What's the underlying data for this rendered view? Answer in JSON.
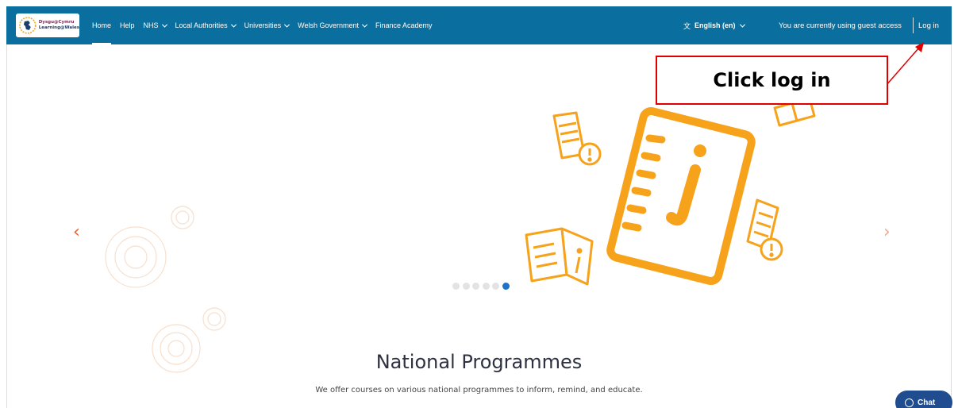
{
  "header": {
    "logo_line1": "Dysgu@Cymru",
    "logo_line2": "Learning@Wales",
    "nav": [
      {
        "label": "Home",
        "dropdown": false
      },
      {
        "label": "Help",
        "dropdown": false
      },
      {
        "label": "NHS",
        "dropdown": true
      },
      {
        "label": "Local Authorities",
        "dropdown": true
      },
      {
        "label": "Universities",
        "dropdown": true
      },
      {
        "label": "Welsh Government",
        "dropdown": true
      },
      {
        "label": "Finance Academy",
        "dropdown": false
      }
    ],
    "language_label": "English (en)",
    "guest_text": "You are currently using guest access",
    "login_label": "Log in"
  },
  "annotation": {
    "text": "Click log in",
    "color": "#e00000"
  },
  "carousel": {
    "prev_glyph": "‹",
    "next_glyph": "›",
    "slide_count": 6,
    "active_index": 5
  },
  "section": {
    "title": "National Programmes",
    "subtitle": "We offer courses on various national programmes to inform, remind, and educate."
  },
  "chat_label": "Chat",
  "colors": {
    "header_bg": "#0a6f9e",
    "accent_orange": "#f7a21b",
    "dot_active": "#1e73c8",
    "chat_bg": "#1f4d8f"
  }
}
